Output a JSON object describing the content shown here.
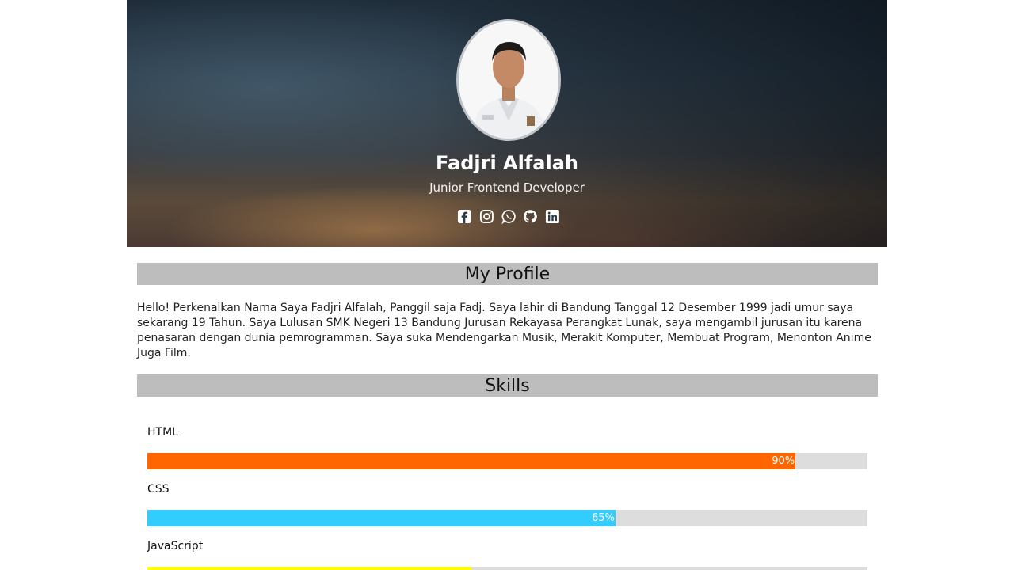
{
  "profile": {
    "name": "Fadjri Alfalah",
    "title": "Junior Frontend Developer",
    "social_icons": [
      "facebook-icon",
      "instagram-icon",
      "whatsapp-icon",
      "github-icon",
      "linkedin-icon"
    ]
  },
  "sections": {
    "profile_heading": "My Profile",
    "about_text": "Hello! Perkenalkan Nama Saya Fadjri Alfalah, Panggil saja Fadj. Saya lahir di Bandung Tanggal 12 Desember 1999 jadi umur saya sekarang 19 Tahun. Saya Lulusan SMK Negeri 13 Bandung Jurusan Rekayasa Perangkat Lunak, saya mengambil jurusan itu karena penasaran dengan dunia pemrogramman. Saya suka Mendengarkan Musik, Merakit Komputer, Membuat Program, Menonton Anime Juga Film.",
    "skills_heading": "Skills"
  },
  "skills": [
    {
      "name": "HTML",
      "percent": 90,
      "label": "90%",
      "color": "#ff6600"
    },
    {
      "name": "CSS",
      "percent": 65,
      "label": "65%",
      "color": "#33ccff"
    },
    {
      "name": "JavaScript",
      "percent": 45,
      "label": "",
      "color": "#ffff00"
    }
  ],
  "colors": {
    "section_bar": "#bdbdbd",
    "track": "#dddddd"
  }
}
